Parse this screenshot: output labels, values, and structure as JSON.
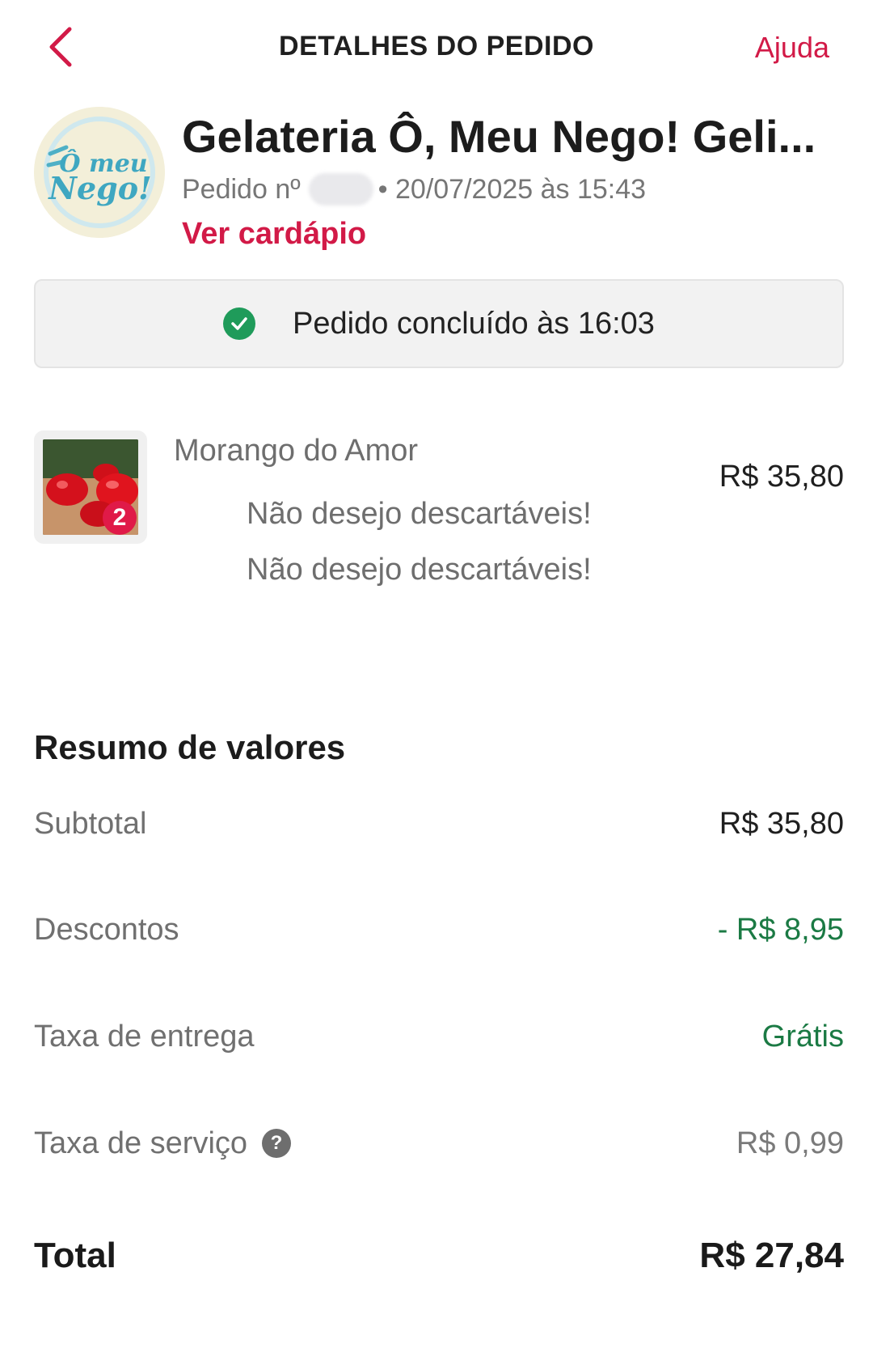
{
  "header": {
    "title": "DETALHES DO PEDIDO",
    "help_label": "Ajuda",
    "accent_color": "#d21a47"
  },
  "store": {
    "logo_text_1": "Ô meu",
    "logo_text_2": "Nego!",
    "name": "Gelateria Ô, Meu Nego! Geli...",
    "order_prefix": "Pedido nº",
    "order_datetime": "• 20/07/2025 às 15:43",
    "menu_link": "Ver cardápio"
  },
  "status": {
    "text": "Pedido concluído às 16:03",
    "icon": "check-circle-icon",
    "color": "#1f9b5a"
  },
  "item": {
    "name": "Morango do Amor",
    "quantity": "2",
    "price": "R$ 35,80",
    "notes": [
      "Não desejo descartáveis!",
      "Não desejo descartáveis!"
    ]
  },
  "summary": {
    "title": "Resumo de valores",
    "subtotal_label": "Subtotal",
    "subtotal_value": "R$ 35,80",
    "discounts_label": "Descontos",
    "discounts_value": "- R$ 8,95",
    "delivery_label": "Taxa de entrega",
    "delivery_value": "Grátis",
    "service_label": "Taxa de serviço",
    "service_value": "R$ 0,99",
    "total_label": "Total",
    "total_value": "R$ 27,84",
    "discount_color": "#1b7a44"
  }
}
